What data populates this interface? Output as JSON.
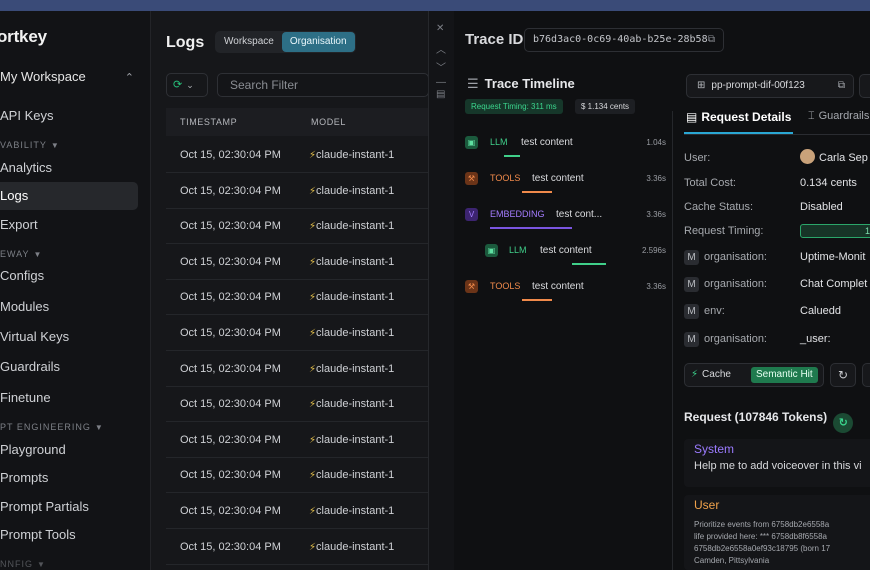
{
  "brand": "ortkey",
  "workspace_label": "My Workspace",
  "sidebar": {
    "items": [
      {
        "label": "API Keys"
      },
      {
        "label": "Analytics"
      },
      {
        "label": "Logs"
      },
      {
        "label": "Export"
      },
      {
        "label": "Configs"
      },
      {
        "label": "Modules"
      },
      {
        "label": "Virtual Keys"
      },
      {
        "label": "Guardrails"
      },
      {
        "label": "Finetune"
      },
      {
        "label": "Playground"
      },
      {
        "label": "Prompts"
      },
      {
        "label": "Prompt Partials"
      },
      {
        "label": "Prompt Tools"
      }
    ],
    "sections": [
      "VABILITY",
      "EWAY",
      "PT ENGINEERING",
      "NNFIG"
    ]
  },
  "logs": {
    "title": "Logs",
    "scope_options": [
      "Workspace",
      "Organisation"
    ],
    "search_placeholder": "Search Filter",
    "columns": [
      "TIMESTAMP",
      "MODEL"
    ],
    "rows": [
      {
        "timestamp": "Oct 15, 02:30:04 PM",
        "model": "claude-instant-1"
      },
      {
        "timestamp": "Oct 15, 02:30:04 PM",
        "model": "claude-instant-1"
      },
      {
        "timestamp": "Oct 15, 02:30:04 PM",
        "model": "claude-instant-1"
      },
      {
        "timestamp": "Oct 15, 02:30:04 PM",
        "model": "claude-instant-1"
      },
      {
        "timestamp": "Oct 15, 02:30:04 PM",
        "model": "claude-instant-1"
      },
      {
        "timestamp": "Oct 15, 02:30:04 PM",
        "model": "claude-instant-1"
      },
      {
        "timestamp": "Oct 15, 02:30:04 PM",
        "model": "claude-instant-1"
      },
      {
        "timestamp": "Oct 15, 02:30:04 PM",
        "model": "claude-instant-1"
      },
      {
        "timestamp": "Oct 15, 02:30:04 PM",
        "model": "claude-instant-1"
      },
      {
        "timestamp": "Oct 15, 02:30:04 PM",
        "model": "claude-instant-1"
      },
      {
        "timestamp": "Oct 15, 02:30:04 PM",
        "model": "claude-instant-1"
      },
      {
        "timestamp": "Oct 15, 02:30:04 PM",
        "model": "claude-instant-1"
      }
    ]
  },
  "trace": {
    "label": "Trace ID",
    "id": "b76d3ac0-0c69-40ab-b25e-28b58",
    "timeline_title": "Trace Timeline",
    "timing_badge": "Request Timing: 311 ms",
    "cost_badge": "$ 1.134 cents",
    "spans": [
      {
        "type": "LLM",
        "text": "test content",
        "duration": "1.04s",
        "kind": "llm"
      },
      {
        "type": "TOOLS",
        "text": "test content",
        "duration": "3.36s",
        "kind": "tools"
      },
      {
        "type": "EMBEDDING",
        "text": "test cont...",
        "duration": "3.36s",
        "kind": "emb"
      },
      {
        "type": "LLM",
        "text": "test content",
        "duration": "2.596s",
        "kind": "llm"
      },
      {
        "type": "TOOLS",
        "text": "test content",
        "duration": "3.36s",
        "kind": "tools"
      }
    ]
  },
  "details": {
    "prompt_id": "pp-prompt-dif-00f123",
    "tabs": [
      "Request Details",
      "Guardrails"
    ],
    "fields": [
      {
        "key": "User:",
        "value": "Carla Sep"
      },
      {
        "key": "Total Cost:",
        "value": "0.134 cents"
      },
      {
        "key": "Cache Status:",
        "value": "Disabled"
      },
      {
        "key": "Request Timing:",
        "value": "13"
      }
    ],
    "metadata": [
      {
        "key": "organisation:",
        "value": "Uptime-Monit"
      },
      {
        "key": "organisation:",
        "value": "Chat Complet"
      },
      {
        "key": "env:",
        "value": "Caluedd"
      },
      {
        "key": "organisation:",
        "value": "_user:"
      }
    ],
    "metadata_badge": "M",
    "cache_label": "Cache",
    "cache_tag": "Semantic Hit",
    "request_heading": "Request (107846 Tokens)",
    "messages": [
      {
        "role": "System",
        "text": "Help me to add voiceover in this vi"
      },
      {
        "role": "User",
        "lines": [
          "Prioritize events from 6758db2e6558a",
          "life provided here: *** 6758db8f6558a",
          "6758db2e6558a0ef93c18795 (born 17",
          "Camden, Pittsylvania"
        ]
      }
    ]
  },
  "colors": {
    "accent": "#2d6f86",
    "llm": "#40d08a",
    "tools": "#f08a4b",
    "embedding": "#a47cff",
    "system_role": "#9b7bff",
    "user_role": "#f0a24b"
  }
}
